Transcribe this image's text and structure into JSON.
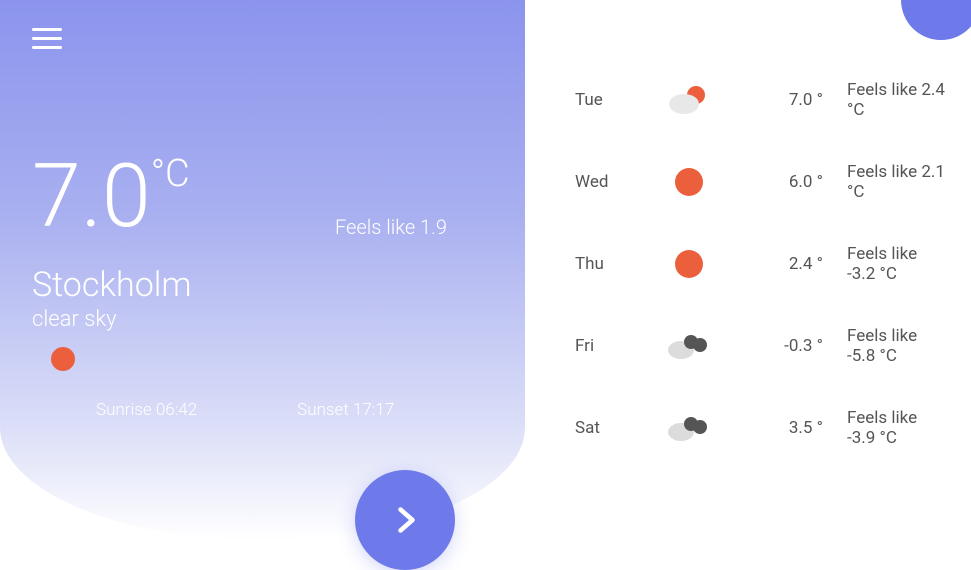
{
  "current": {
    "temp": "7.0",
    "unit": "°C",
    "feels_like_label": "Feels like 1.9",
    "city": "Stockholm",
    "description": "clear sky",
    "sunrise_label": "Sunrise 06:42",
    "sunset_label": "Sunset 17:17",
    "icon": "sun"
  },
  "forecast": [
    {
      "day": "Tue",
      "icon": "partly-cloudy",
      "temp": "7.0 °",
      "feels": "Feels like 2.4 °C"
    },
    {
      "day": "Wed",
      "icon": "sun",
      "temp": "6.0 °",
      "feels": "Feels like 2.1 °C"
    },
    {
      "day": "Thu",
      "icon": "sun",
      "temp": "2.4 °",
      "feels": "Feels like -3.2 °C"
    },
    {
      "day": "Fri",
      "icon": "cloudy",
      "temp": "-0.3 °",
      "feels": "Feels like -5.8 °C"
    },
    {
      "day": "Sat",
      "icon": "cloudy",
      "temp": "3.5 °",
      "feels": "Feels like -3.9 °C"
    }
  ],
  "colors": {
    "sun": "#ec5f3c",
    "cloud_light": "#dcdcdc",
    "cloud_dark": "#555"
  }
}
